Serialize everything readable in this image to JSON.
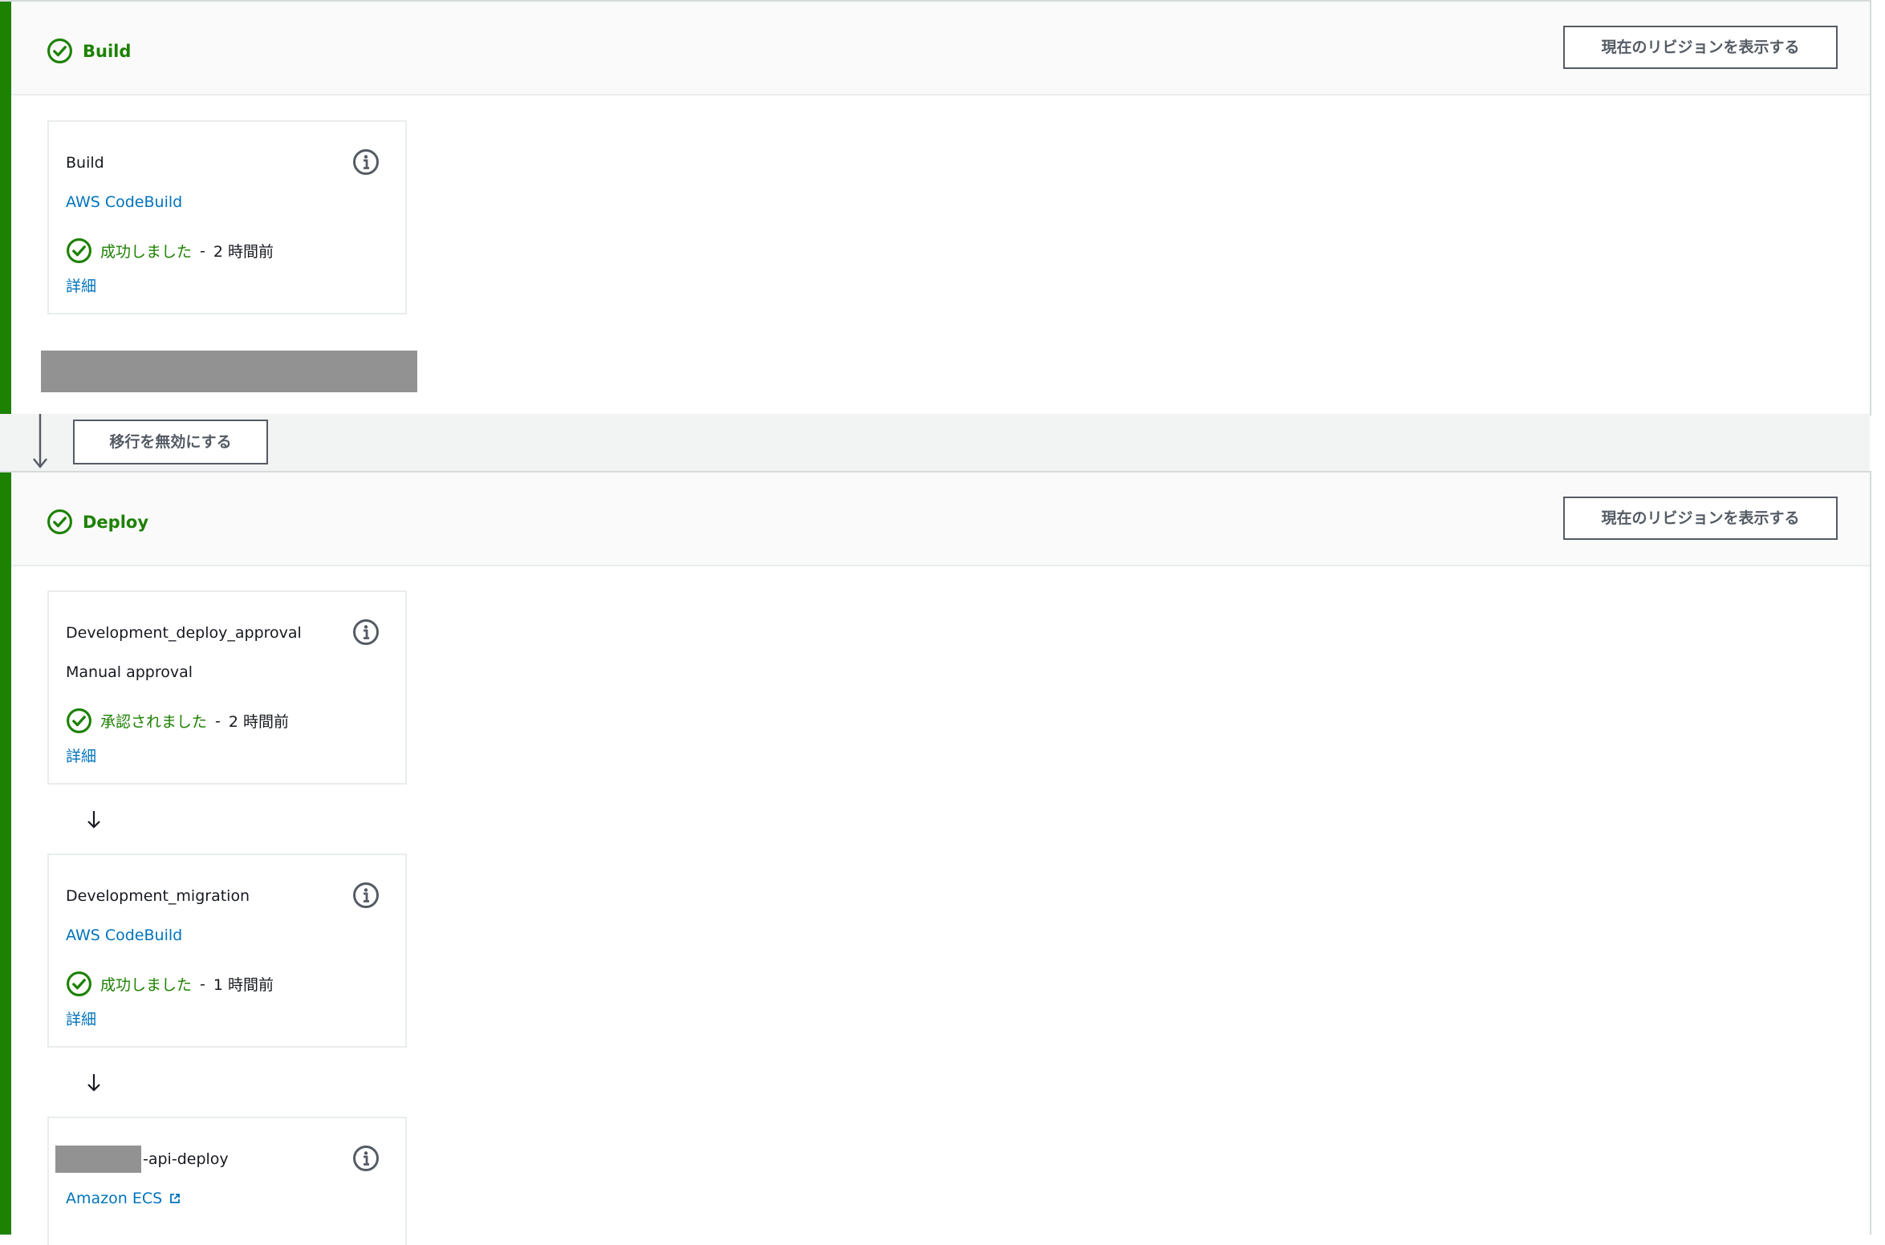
{
  "stages": {
    "build": {
      "title": "Build",
      "status": "succeeded",
      "revision_button": "現在のリビジョンを表示する",
      "actions": [
        {
          "name": "Build",
          "provider": "AWS CodeBuild",
          "status_text": "成功しました",
          "separator": "-",
          "time": "2 時間前",
          "details": "詳細"
        }
      ]
    },
    "transition": {
      "disable_button": "移行を無効にする"
    },
    "deploy": {
      "title": "Deploy",
      "status": "succeeded",
      "revision_button": "現在のリビジョンを表示する",
      "actions": [
        {
          "name": "Development_deploy_approval",
          "provider": "Manual approval",
          "status_text": "承認されました",
          "separator": "-",
          "time": "2 時間前",
          "details": "詳細"
        },
        {
          "name": "Development_migration",
          "provider": "AWS CodeBuild",
          "status_text": "成功しました",
          "separator": "-",
          "time": "1 時間前",
          "details": "詳細"
        },
        {
          "name": "-api-deploy",
          "provider": "Amazon ECS"
        }
      ]
    }
  },
  "colors": {
    "success": "#1d8102",
    "link": "#0073bb",
    "button_border": "#545b64",
    "redacted": "#929292"
  },
  "icons": {
    "status": "check-circle-icon",
    "info": "info-icon",
    "external": "external-link-icon",
    "arrow": "arrow-down-icon"
  }
}
